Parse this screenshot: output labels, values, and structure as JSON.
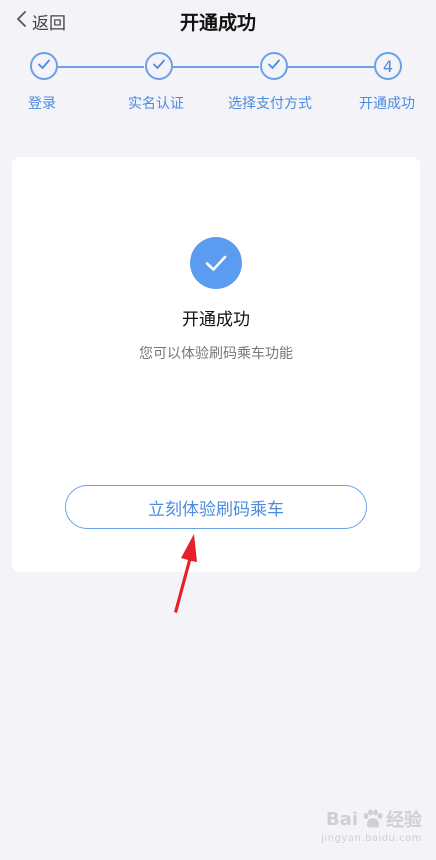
{
  "nav": {
    "back_label": "返回",
    "title": "开通成功"
  },
  "steps": [
    {
      "label": "登录",
      "state": "done",
      "icon": "check-icon"
    },
    {
      "label": "实名认证",
      "state": "done",
      "icon": "check-icon"
    },
    {
      "label": "选择支付方式",
      "state": "done",
      "icon": "check-icon"
    },
    {
      "label": "开通成功",
      "state": "current",
      "number": "4"
    }
  ],
  "card": {
    "icon": "check-icon",
    "title": "开通成功",
    "description": "您可以体验刷码乘车功能",
    "button_label": "立刻体验刷码乘车"
  },
  "watermark": {
    "brand_prefix": "Bai",
    "brand_suffix": "经验",
    "sub": "jingyan.baidu.com"
  },
  "colors": {
    "accent": "#5b9bf0",
    "step_blue": "#4b8be0",
    "background": "#f3f3f8",
    "annotation_arrow": "#e8202a"
  }
}
